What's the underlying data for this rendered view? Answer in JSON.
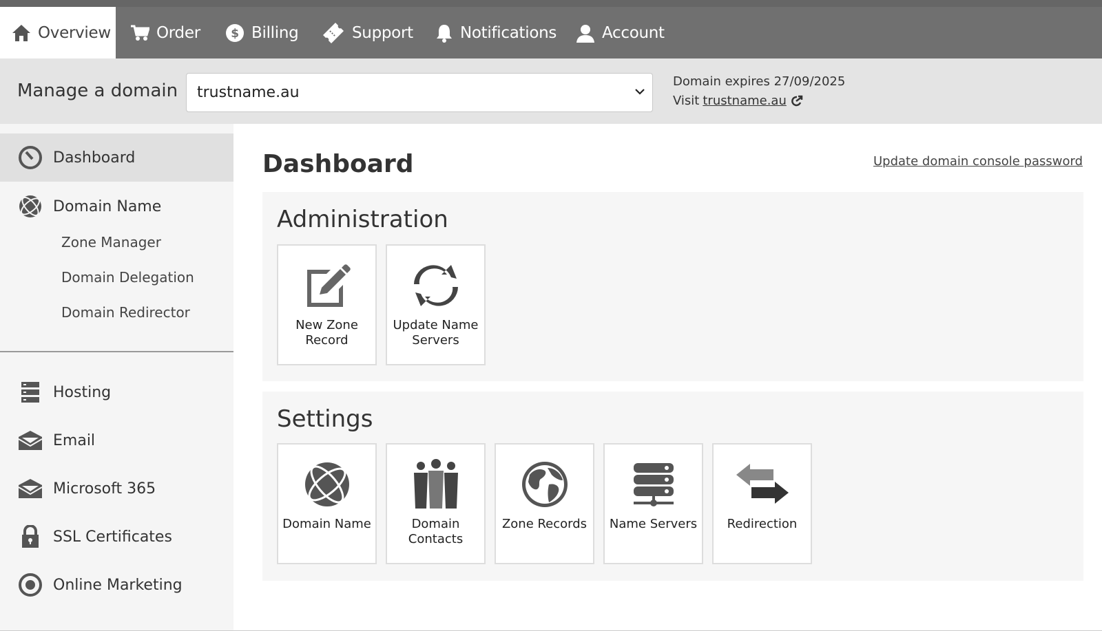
{
  "nav": {
    "items": [
      {
        "label": "Overview",
        "icon": "home-icon",
        "active": true
      },
      {
        "label": "Order",
        "icon": "cart-icon"
      },
      {
        "label": "Billing",
        "icon": "dollar-icon"
      },
      {
        "label": "Support",
        "icon": "ticket-icon"
      },
      {
        "label": "Notifications",
        "icon": "bell-icon"
      },
      {
        "label": "Account",
        "icon": "user-icon"
      }
    ]
  },
  "domainbar": {
    "label": "Manage a domain",
    "selected_domain": "trustname.au",
    "expiry": "Domain expires 27/09/2025",
    "visit_prefix": "Visit",
    "visit_link": "trustname.au"
  },
  "sidebar": {
    "items": [
      {
        "label": "Dashboard",
        "icon": "dashboard-icon",
        "active": true
      },
      {
        "label": "Domain Name",
        "icon": "globe-icon"
      },
      {
        "label": "Hosting",
        "icon": "server-icon"
      },
      {
        "label": "Email",
        "icon": "envelope-icon"
      },
      {
        "label": "Microsoft 365",
        "icon": "envelope-icon"
      },
      {
        "label": "SSL Certificates",
        "icon": "lock-icon"
      },
      {
        "label": "Online Marketing",
        "icon": "target-icon"
      }
    ],
    "subitems": [
      "Zone Manager",
      "Domain Delegation",
      "Domain Redirector"
    ]
  },
  "main": {
    "title": "Dashboard",
    "password_link": "Update domain console password",
    "administration": {
      "heading": "Administration",
      "tiles": [
        {
          "label": "New Zone Record",
          "icon": "edit-icon"
        },
        {
          "label": "Update Name Servers",
          "icon": "refresh-icon"
        }
      ]
    },
    "settings": {
      "heading": "Settings",
      "tiles": [
        {
          "label": "Domain Name",
          "icon": "globe-icon"
        },
        {
          "label": "Domain Contacts",
          "icon": "people-icon"
        },
        {
          "label": "Zone Records",
          "icon": "world-icon"
        },
        {
          "label": "Name Servers",
          "icon": "server-stack-icon"
        },
        {
          "label": "Redirection",
          "icon": "arrows-icon"
        }
      ]
    }
  },
  "colors": {
    "nav_bg": "#707070",
    "domainbar_bg": "#e4e4e4",
    "sidebar_bg": "#f5f5f5",
    "sidebar_active": "#e0e0e0",
    "panel_bg": "#f6f6f6",
    "icon_gray": "#555555"
  }
}
